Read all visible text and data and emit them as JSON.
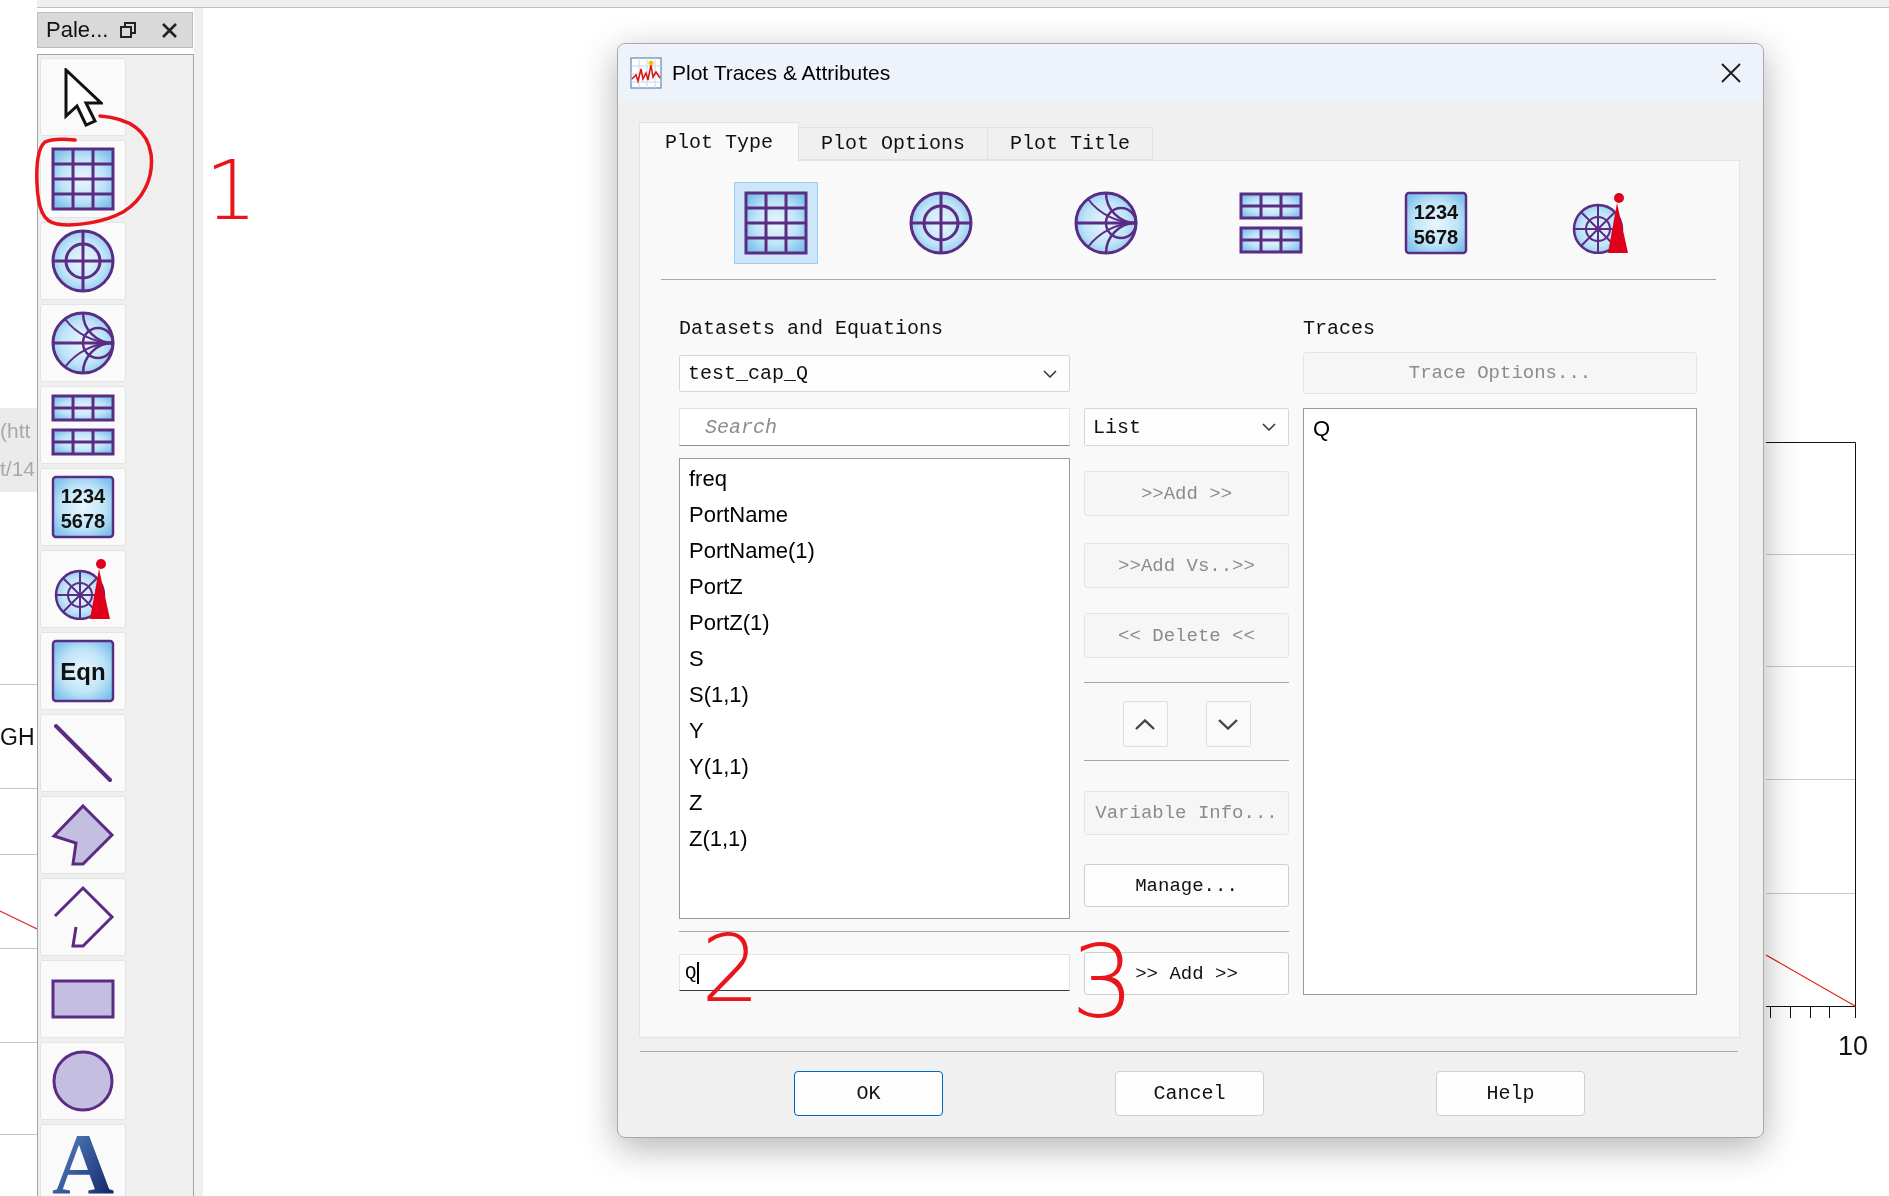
{
  "left_window": {
    "link_lines": [
      "(htt",
      "t/14"
    ],
    "axis_text": "GH"
  },
  "palette": {
    "title": "Pale...",
    "note": "1",
    "tools": [
      {
        "kind": "pointer",
        "circled": false
      },
      {
        "kind": "rectangular",
        "circled": true
      },
      {
        "kind": "polar",
        "circled": false
      },
      {
        "kind": "smith",
        "circled": false
      },
      {
        "kind": "stacked",
        "circled": false
      },
      {
        "kind": "numeric",
        "lines": [
          "1234",
          "5678"
        ],
        "circled": false
      },
      {
        "kind": "antenna",
        "circled": false
      },
      {
        "kind": "equation",
        "text": "Eqn",
        "circled": false
      },
      {
        "kind": "line",
        "circled": false
      },
      {
        "kind": "polygon",
        "circled": false
      },
      {
        "kind": "polyline",
        "circled": false
      },
      {
        "kind": "rectangle",
        "circled": false
      },
      {
        "kind": "ellipse",
        "circled": false
      },
      {
        "kind": "text",
        "text": "A",
        "circled": false
      }
    ]
  },
  "dialog": {
    "title": "Plot Traces & Attributes",
    "tabs": [
      {
        "label": "Plot Type",
        "selected": true
      },
      {
        "label": "Plot Options",
        "selected": false
      },
      {
        "label": "Plot Title",
        "selected": false
      }
    ],
    "plot_types": [
      {
        "kind": "rectangular",
        "selected": true
      },
      {
        "kind": "polar",
        "selected": false
      },
      {
        "kind": "smith",
        "selected": false
      },
      {
        "kind": "stacked",
        "selected": false
      },
      {
        "kind": "numeric",
        "lines": [
          "1234",
          "5678"
        ],
        "selected": false
      },
      {
        "kind": "antenna",
        "selected": false
      }
    ],
    "datasets": {
      "label": "Datasets and Equations",
      "dataset_select": {
        "value": "test_cap_Q"
      },
      "search": {
        "placeholder": "Search"
      },
      "view_select": {
        "value": "List"
      },
      "variables": [
        "freq",
        "PortName",
        "PortName(1)",
        "PortZ",
        "PortZ(1)",
        "S",
        "S(1,1)",
        "Y",
        "Y(1,1)",
        "Z",
        "Z(1,1)"
      ]
    },
    "transfer_buttons": [
      {
        "label": ">>Add >>",
        "disabled": true
      },
      {
        "label": ">>Add Vs..>>",
        "disabled": true
      },
      {
        "label": "<< Delete <<",
        "disabled": true
      }
    ],
    "info_buttons": [
      {
        "label": "Variable Info...",
        "disabled": true
      },
      {
        "label": "Manage...",
        "disabled": false
      }
    ],
    "expression": {
      "value": "Q",
      "focused": true,
      "note": "2"
    },
    "add_button": {
      "label": ">> Add >>",
      "disabled": false,
      "note": "3"
    },
    "traces": {
      "label": "Traces",
      "options_button": {
        "label": "Trace Options...",
        "disabled": true
      },
      "items": [
        "Q"
      ]
    },
    "footer_buttons": [
      {
        "label": "OK",
        "default": true
      },
      {
        "label": "Cancel",
        "default": false
      },
      {
        "label": "Help",
        "default": false
      }
    ]
  },
  "background_plot": {
    "tick_label": "10"
  }
}
